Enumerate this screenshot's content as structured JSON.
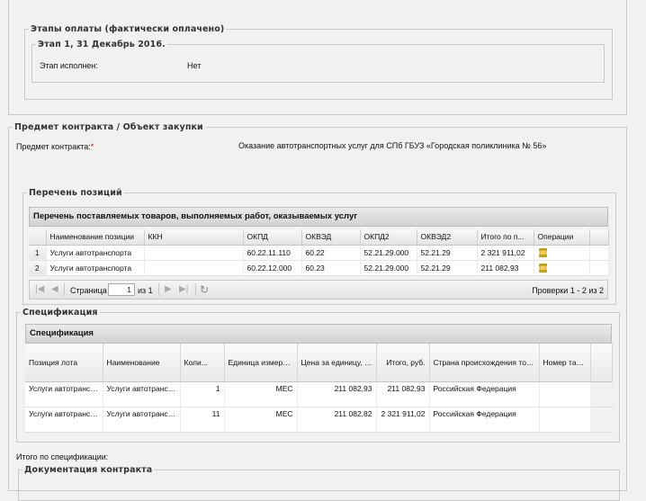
{
  "payment_stages": {
    "legend": "Этапы оплаты (фактически оплачено)",
    "stage": {
      "legend": "Этап 1, 31 Декабрь 2016.",
      "label": "Этап исполнен:",
      "value": "Нет"
    }
  },
  "subject": {
    "legend": "Предмет контракта / Объект закупки",
    "label": "Предмет контракта:",
    "required_mark": "*",
    "value": "Оказание автотранспортных услуг для СПб ГБУЗ «Городская поликлиника № 56»"
  },
  "positions": {
    "legend": "Перечень позиций",
    "caption": "Перечень поставляемых товаров, выполняемых работ, оказываемых услуг",
    "columns": [
      "Наименование позиции",
      "ККН",
      "ОКПД",
      "ОКВЭД",
      "ОКПД2",
      "ОКВЭД2",
      "Итого по п...",
      "Операции"
    ],
    "rows": [
      {
        "num": "1",
        "name": "Услуги автотранспорта",
        "kkn": "",
        "okpd": "60.22.11.110",
        "okved": "60.22",
        "okpd2": "52.21.29.000",
        "okved2": "52.21.29",
        "total": "2 321 911,02",
        "ops_icon": "scroll-icon"
      },
      {
        "num": "2",
        "name": "Услуги автотранспорта",
        "kkn": "",
        "okpd": "60.22.12.000",
        "okved": "60.23",
        "okpd2": "52.21.29.000",
        "okved2": "52.21.29",
        "total": "211 082,93",
        "ops_icon": "scroll-icon"
      }
    ],
    "pager": {
      "page_label": "Страница",
      "page_value": "1",
      "of_label": "из 1",
      "summary": "Проверки 1 - 2 из 2"
    }
  },
  "spec": {
    "legend": "Спецификация",
    "caption": "Спецификация",
    "columns": [
      "Позиция лота",
      "Наименование",
      "Коли...",
      "Единица измерения",
      "Цена за единицу, руб.",
      "Итого, руб.",
      "Страна происхождения товара",
      "Номер таможенной декларации"
    ],
    "rows": [
      {
        "lot": "Услуги автотранспорта",
        "name": "Услуги автотранспорта",
        "qty": "1",
        "unit": "МЕС",
        "price": "211 082,93",
        "total": "211 082,93",
        "country": "Российская Федерация",
        "decl": ""
      },
      {
        "lot": "Услуги автотранспорта",
        "name": "Услуги автотранспорта",
        "qty": "11",
        "unit": "МЕС",
        "price": "211 082,82",
        "total": "2 321 911,02",
        "country": "Российская Федерация",
        "decl": ""
      }
    ]
  },
  "spec_total_label": "Итого по спецификации:",
  "docs_legend": "Документация контракта"
}
